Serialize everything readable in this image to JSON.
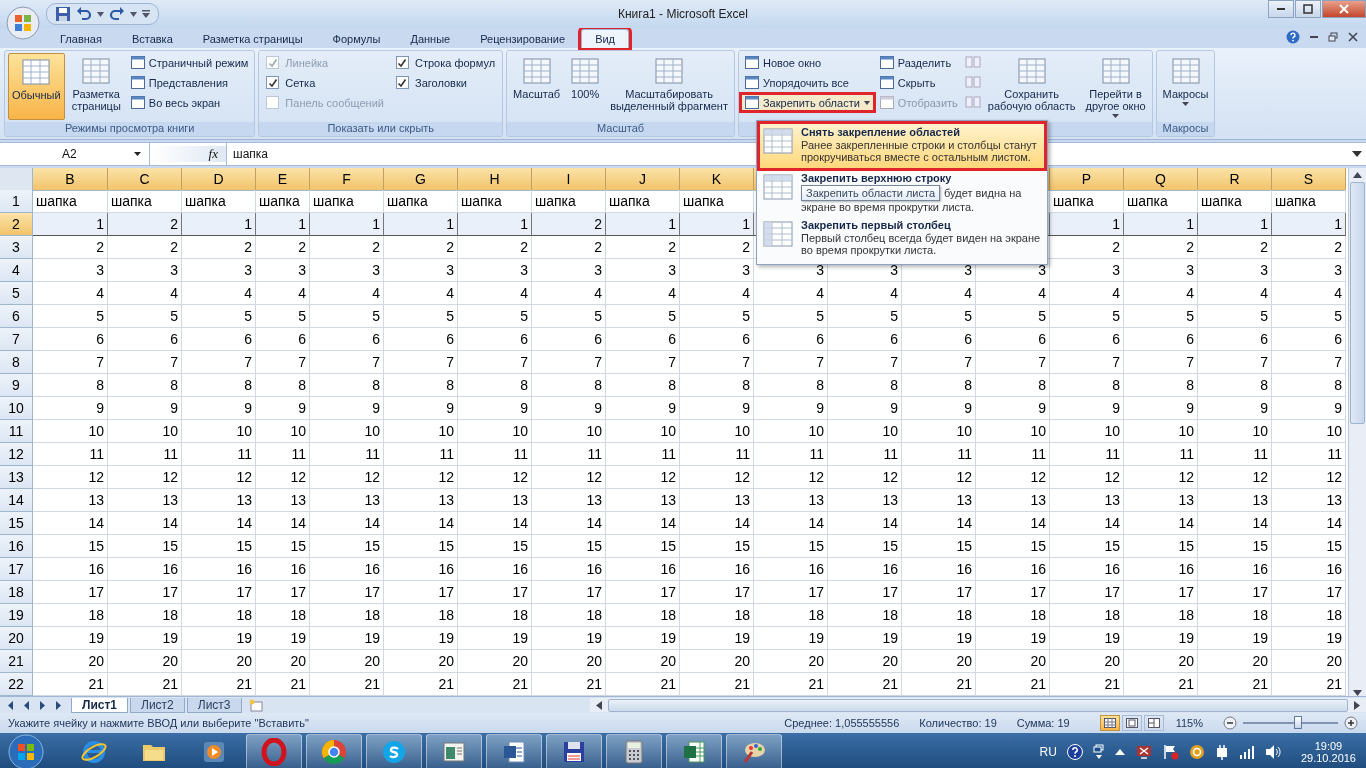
{
  "title_bar": {
    "title": "Книга1 - Microsoft Excel"
  },
  "ribbon_tabs": [
    {
      "label": "Главная",
      "selected": false,
      "highlighted": false
    },
    {
      "label": "Вставка",
      "selected": false,
      "highlighted": false
    },
    {
      "label": "Разметка страницы",
      "selected": false,
      "highlighted": false
    },
    {
      "label": "Формулы",
      "selected": false,
      "highlighted": false
    },
    {
      "label": "Данные",
      "selected": false,
      "highlighted": false
    },
    {
      "label": "Рецензирование",
      "selected": false,
      "highlighted": false
    },
    {
      "label": "Вид",
      "selected": true,
      "highlighted": true
    }
  ],
  "ribbon": {
    "groups": [
      {
        "label": "Режимы просмотра книги",
        "columns": [
          {
            "kind": "big",
            "label": "Обычный",
            "selected": true
          },
          {
            "kind": "big",
            "label": "Разметка\nстраницы",
            "selected": false
          },
          {
            "kind": "stack",
            "items": [
              {
                "kind": "button",
                "label": "Страничный режим",
                "disabled": false
              },
              {
                "kind": "button",
                "label": "Представления",
                "disabled": false
              },
              {
                "kind": "button",
                "label": "Во весь экран",
                "disabled": false
              }
            ]
          }
        ]
      },
      {
        "label": "Показать или скрыть",
        "columns": [
          {
            "kind": "stack",
            "items": [
              {
                "kind": "check",
                "label": "Линейка",
                "checked": true,
                "disabled": true
              },
              {
                "kind": "check",
                "label": "Сетка",
                "checked": true,
                "disabled": false
              },
              {
                "kind": "check",
                "label": "Панель сообщений",
                "checked": false,
                "disabled": true
              }
            ]
          },
          {
            "kind": "stack",
            "items": [
              {
                "kind": "check",
                "label": "Строка формул",
                "checked": true,
                "disabled": false
              },
              {
                "kind": "check",
                "label": "Заголовки",
                "checked": true,
                "disabled": false
              }
            ]
          }
        ]
      },
      {
        "label": "Масштаб",
        "columns": [
          {
            "kind": "big",
            "label": "Масштаб",
            "selected": false
          },
          {
            "kind": "big",
            "label": "100%",
            "selected": false
          },
          {
            "kind": "big",
            "label": "Масштабировать\nвыделенный фрагмент",
            "selected": false
          }
        ]
      },
      {
        "columns": [
          {
            "kind": "stack",
            "items": [
              {
                "kind": "button",
                "label": "Новое окно",
                "disabled": false
              },
              {
                "kind": "button",
                "label": "Упорядочить все",
                "disabled": false
              },
              {
                "kind": "button",
                "label": "Закрепить области",
                "disabled": false,
                "dropdown": true,
                "highlighted": true
              }
            ]
          },
          {
            "kind": "stack",
            "items": [
              {
                "kind": "button",
                "label": "Разделить",
                "disabled": false
              },
              {
                "kind": "button",
                "label": "Скрыть",
                "disabled": false
              },
              {
                "kind": "button",
                "label": "Отобразить",
                "disabled": true
              }
            ]
          },
          {
            "kind": "icon_stack"
          },
          {
            "kind": "big",
            "label": "Сохранить\nрабочую область",
            "selected": false
          },
          {
            "kind": "big",
            "label": "Перейти в\nдругое окно",
            "selected": false,
            "dropdown": true
          }
        ]
      },
      {
        "label": "Макросы",
        "columns": [
          {
            "kind": "big",
            "label": "Макросы",
            "selected": false,
            "dropdown": true
          }
        ]
      }
    ]
  },
  "formula_bar": {
    "name_box": "A2",
    "fx": "fx",
    "value": "шапка"
  },
  "freeze_menu": {
    "items": [
      {
        "title": "Снять закрепление областей",
        "description": "Ранее закрепленные строки и столбцы станут прокручиваться вместе с остальным листом.",
        "hovered": true,
        "highlighted": true
      },
      {
        "title": "Закрепить верхнюю строку",
        "tooltip": "Закрепить области листа",
        "description": "будет видна на экране во время прокрутки листа.",
        "hovered": false,
        "highlighted": false
      },
      {
        "title": "Закрепить первый столбец",
        "description": "Первый столбец всегда будет виден на экране во время прокрутки листа.",
        "hovered": false,
        "highlighted": false
      }
    ]
  },
  "sheet": {
    "columns": [
      "B",
      "C",
      "D",
      "E",
      "F",
      "G",
      "H",
      "I",
      "J",
      "K",
      null,
      null,
      null,
      null,
      "P",
      "Q",
      "R",
      "S"
    ],
    "rows": [
      {
        "header": "1",
        "kind": "text",
        "selected": false,
        "cells": [
          "шапка",
          "шапка",
          "шапка",
          "шапка",
          "шапка",
          "шапка",
          "шапка",
          "шапка",
          "шапка",
          "шапка",
          null,
          null,
          null,
          null,
          "шапка",
          "шапка",
          "шапка",
          "шапка"
        ]
      },
      {
        "header": "2",
        "kind": "number",
        "selected": true,
        "cells": [
          "1",
          "2",
          "1",
          "1",
          "1",
          "1",
          "1",
          "2",
          "1",
          "1",
          null,
          null,
          null,
          null,
          "1",
          "1",
          "1",
          "1"
        ]
      },
      {
        "header": "3",
        "kind": "number",
        "selected": false,
        "cells": [
          "2",
          "2",
          "2",
          "2",
          "2",
          "2",
          "2",
          "2",
          "2",
          "2",
          null,
          null,
          null,
          null,
          "2",
          "2",
          "2",
          "2"
        ]
      },
      {
        "header": "4",
        "kind": "number",
        "selected": false,
        "cells": [
          "3",
          "3",
          "3",
          "3",
          "3",
          "3",
          "3",
          "3",
          "3",
          "3",
          "3",
          "3",
          "3",
          "3",
          "3",
          "3",
          "3",
          "3"
        ]
      },
      {
        "header": "5",
        "kind": "number",
        "selected": false,
        "cells": [
          "4",
          "4",
          "4",
          "4",
          "4",
          "4",
          "4",
          "4",
          "4",
          "4",
          "4",
          "4",
          "4",
          "4",
          "4",
          "4",
          "4",
          "4"
        ]
      },
      {
        "header": "6",
        "kind": "number",
        "selected": false,
        "cells": [
          "5",
          "5",
          "5",
          "5",
          "5",
          "5",
          "5",
          "5",
          "5",
          "5",
          "5",
          "5",
          "5",
          "5",
          "5",
          "5",
          "5",
          "5"
        ]
      },
      {
        "header": "7",
        "kind": "number",
        "selected": false,
        "cells": [
          "6",
          "6",
          "6",
          "6",
          "6",
          "6",
          "6",
          "6",
          "6",
          "6",
          "6",
          "6",
          "6",
          "6",
          "6",
          "6",
          "6",
          "6"
        ]
      },
      {
        "header": "8",
        "kind": "number",
        "selected": false,
        "cells": [
          "7",
          "7",
          "7",
          "7",
          "7",
          "7",
          "7",
          "7",
          "7",
          "7",
          "7",
          "7",
          "7",
          "7",
          "7",
          "7",
          "7",
          "7"
        ]
      },
      {
        "header": "9",
        "kind": "number",
        "selected": false,
        "cells": [
          "8",
          "8",
          "8",
          "8",
          "8",
          "8",
          "8",
          "8",
          "8",
          "8",
          "8",
          "8",
          "8",
          "8",
          "8",
          "8",
          "8",
          "8"
        ]
      },
      {
        "header": "10",
        "kind": "number",
        "selected": false,
        "cells": [
          "9",
          "9",
          "9",
          "9",
          "9",
          "9",
          "9",
          "9",
          "9",
          "9",
          "9",
          "9",
          "9",
          "9",
          "9",
          "9",
          "9",
          "9"
        ]
      },
      {
        "header": "11",
        "kind": "number",
        "selected": false,
        "cells": [
          "10",
          "10",
          "10",
          "10",
          "10",
          "10",
          "10",
          "10",
          "10",
          "10",
          "10",
          "10",
          "10",
          "10",
          "10",
          "10",
          "10",
          "10"
        ]
      },
      {
        "header": "12",
        "kind": "number",
        "selected": false,
        "cells": [
          "11",
          "11",
          "11",
          "11",
          "11",
          "11",
          "11",
          "11",
          "11",
          "11",
          "11",
          "11",
          "11",
          "11",
          "11",
          "11",
          "11",
          "11"
        ]
      },
      {
        "header": "13",
        "kind": "number",
        "selected": false,
        "cells": [
          "12",
          "12",
          "12",
          "12",
          "12",
          "12",
          "12",
          "12",
          "12",
          "12",
          "12",
          "12",
          "12",
          "12",
          "12",
          "12",
          "12",
          "12"
        ]
      },
      {
        "header": "14",
        "kind": "number",
        "selected": false,
        "cells": [
          "13",
          "13",
          "13",
          "13",
          "13",
          "13",
          "13",
          "13",
          "13",
          "13",
          "13",
          "13",
          "13",
          "13",
          "13",
          "13",
          "13",
          "13"
        ]
      },
      {
        "header": "15",
        "kind": "number",
        "selected": false,
        "cells": [
          "14",
          "14",
          "14",
          "14",
          "14",
          "14",
          "14",
          "14",
          "14",
          "14",
          "14",
          "14",
          "14",
          "14",
          "14",
          "14",
          "14",
          "14"
        ]
      },
      {
        "header": "16",
        "kind": "number",
        "selected": false,
        "cells": [
          "15",
          "15",
          "15",
          "15",
          "15",
          "15",
          "15",
          "15",
          "15",
          "15",
          "15",
          "15",
          "15",
          "15",
          "15",
          "15",
          "15",
          "15"
        ]
      },
      {
        "header": "17",
        "kind": "number",
        "selected": false,
        "cells": [
          "16",
          "16",
          "16",
          "16",
          "16",
          "16",
          "16",
          "16",
          "16",
          "16",
          "16",
          "16",
          "16",
          "16",
          "16",
          "16",
          "16",
          "16"
        ]
      },
      {
        "header": "18",
        "kind": "number",
        "selected": false,
        "cells": [
          "17",
          "17",
          "17",
          "17",
          "17",
          "17",
          "17",
          "17",
          "17",
          "17",
          "17",
          "17",
          "17",
          "17",
          "17",
          "17",
          "17",
          "17"
        ]
      },
      {
        "header": "19",
        "kind": "number",
        "selected": false,
        "cells": [
          "18",
          "18",
          "18",
          "18",
          "18",
          "18",
          "18",
          "18",
          "18",
          "18",
          "18",
          "18",
          "18",
          "18",
          "18",
          "18",
          "18",
          "18"
        ]
      },
      {
        "header": "20",
        "kind": "number",
        "selected": false,
        "cells": [
          "19",
          "19",
          "19",
          "19",
          "19",
          "19",
          "19",
          "19",
          "19",
          "19",
          "19",
          "19",
          "19",
          "19",
          "19",
          "19",
          "19",
          "19"
        ]
      },
      {
        "header": "21",
        "kind": "number",
        "selected": false,
        "cells": [
          "20",
          "20",
          "20",
          "20",
          "20",
          "20",
          "20",
          "20",
          "20",
          "20",
          "20",
          "20",
          "20",
          "20",
          "20",
          "20",
          "20",
          "20"
        ]
      },
      {
        "header": "22",
        "kind": "number",
        "selected": false,
        "cells": [
          "21",
          "21",
          "21",
          "21",
          "21",
          "21",
          "21",
          "21",
          "21",
          "21",
          "21",
          "21",
          "21",
          "21",
          "21",
          "21",
          "21",
          "21"
        ]
      }
    ]
  },
  "sheet_tabs": [
    {
      "label": "Лист1",
      "selected": true
    },
    {
      "label": "Лист2",
      "selected": false
    },
    {
      "label": "Лист3",
      "selected": false
    }
  ],
  "status_bar": {
    "message": "Укажите ячейку и нажмите ВВОД или выберите \"Вставить\"",
    "average": "Среднее: 1,055555556",
    "count": "Количество: 19",
    "sum": "Сумма: 19",
    "view_buttons": [
      {
        "selected": true
      },
      {
        "selected": false
      },
      {
        "selected": false
      }
    ],
    "zoom": {
      "reading": "115%",
      "level": 0.58
    }
  },
  "taskbar": {
    "apps": [
      {
        "running": false
      },
      {
        "running": false
      },
      {
        "running": false
      },
      {
        "running": true
      },
      {
        "running": true
      },
      {
        "running": true
      },
      {
        "running": true
      },
      {
        "running": true
      },
      {
        "running": true
      },
      {
        "running": true
      },
      {
        "running": true
      },
      {
        "running": true
      }
    ],
    "language": "RU",
    "time": "19:09",
    "date": "29.10.2016"
  }
}
